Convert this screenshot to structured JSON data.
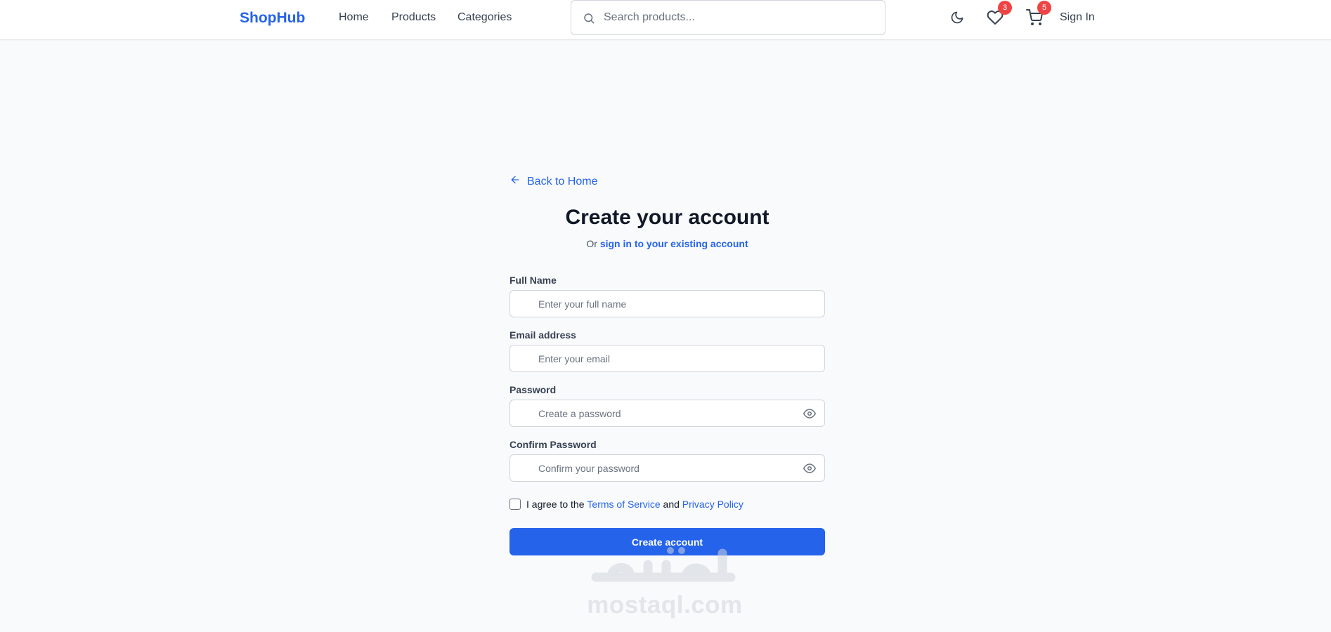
{
  "header": {
    "logo": "ShopHub",
    "nav": [
      {
        "label": "Home"
      },
      {
        "label": "Products"
      },
      {
        "label": "Categories"
      }
    ],
    "search_placeholder": "Search products...",
    "wishlist_count": "3",
    "cart_count": "5",
    "sign_in_label": "Sign In"
  },
  "form": {
    "back_label": "Back to Home",
    "title": "Create your account",
    "subtitle_prefix": "Or",
    "subtitle_link": "sign in to your existing account",
    "fields": [
      {
        "label": "Full Name",
        "placeholder": "Enter your full name",
        "value": ""
      },
      {
        "label": "Email address",
        "placeholder": "Enter your email",
        "value": ""
      },
      {
        "label": "Password",
        "placeholder": "Create a password",
        "value": ""
      },
      {
        "label": "Confirm Password",
        "placeholder": "Confirm your password",
        "value": ""
      }
    ],
    "terms": {
      "prefix": "I agree to the",
      "terms_link": "Terms of Service",
      "and": "and",
      "privacy_link": "Privacy Policy",
      "checked": false
    },
    "submit_label": "Create account"
  },
  "watermark": {
    "text": "mostaql.com"
  },
  "colors": {
    "accent": "#2563eb",
    "badge": "#ef4444",
    "background": "#f8fafc"
  },
  "icons": [
    "search-icon",
    "moon-icon",
    "heart-icon",
    "cart-icon",
    "arrow-left-icon",
    "eye-icon"
  ]
}
